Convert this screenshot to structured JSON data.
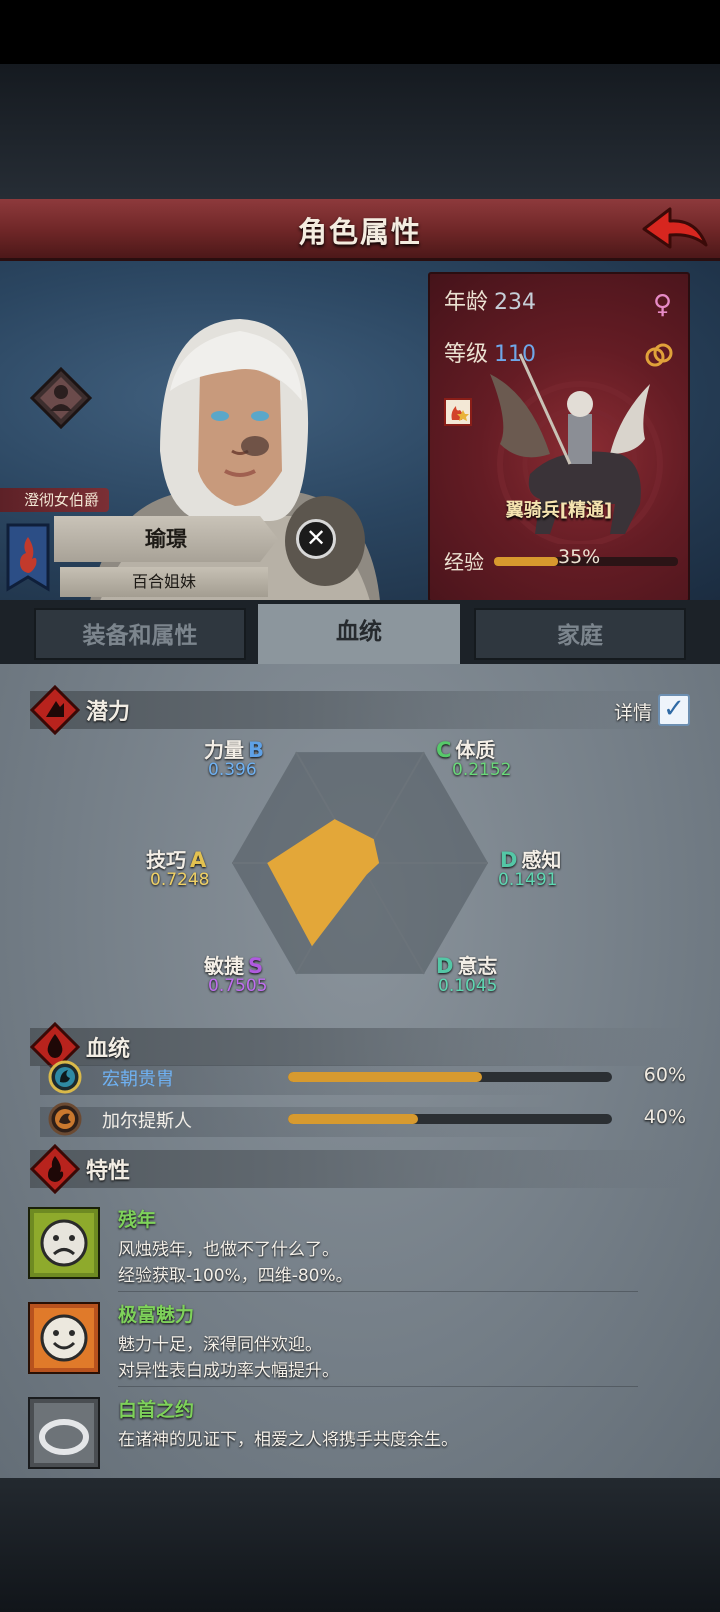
{
  "header": {
    "title": "角色属性"
  },
  "character": {
    "title_badge": "澄彻女伯爵",
    "name": "瑜璟",
    "house": "百合姐妹"
  },
  "unit": {
    "age_label": "年龄",
    "age_value": "234",
    "level_label": "等级",
    "level_value": "110",
    "unit_name": "翼骑兵[精通]",
    "exp_label": "经验",
    "exp_percent": "35%",
    "exp_fraction": 0.35
  },
  "tabs": [
    {
      "label": "装备和属性",
      "active": false
    },
    {
      "label": "血统",
      "active": true
    },
    {
      "label": "家庭",
      "active": false
    }
  ],
  "potential": {
    "section_title": "潜力",
    "detail_label": "详情",
    "detail_checked": true,
    "stats": [
      {
        "label": "力量",
        "grade": "B",
        "value": "0.396"
      },
      {
        "label": "体质",
        "grade": "C",
        "value": "0.2152"
      },
      {
        "label": "感知",
        "grade": "D",
        "value": "0.1491"
      },
      {
        "label": "意志",
        "grade": "D",
        "value": "0.1045"
      },
      {
        "label": "敏捷",
        "grade": "S",
        "value": "0.7505"
      },
      {
        "label": "技巧",
        "grade": "A",
        "value": "0.7248"
      }
    ]
  },
  "bloodline": {
    "section_title": "血统",
    "items": [
      {
        "name": "宏朝贵胄",
        "percent": "60%",
        "fraction": 0.6
      },
      {
        "name": "加尔提斯人",
        "percent": "40%",
        "fraction": 0.4
      }
    ]
  },
  "traits": {
    "section_title": "特性",
    "items": [
      {
        "name": "残年",
        "line1": "风烛残年，也做不了什么了。",
        "line2": "经验获取-100%，四维-80%。"
      },
      {
        "name": "极富魅力",
        "line1": "魅力十足，深得同伴欢迎。",
        "line2": "对异性表白成功率大幅提升。"
      },
      {
        "name": "白首之约",
        "line1": "在诸神的见证下，相爱之人将携手共度余生。",
        "line2": ""
      }
    ]
  },
  "colors": {
    "header_red": "#7a2c2e",
    "grade_S": "#b05ae0",
    "grade_A": "#e2c150",
    "grade_B": "#5fa1e6",
    "grade_C": "#57c96a",
    "grade_D": "#54c7a6",
    "bar_fill": "#d79a2f",
    "trait_green": "#7ed25a"
  }
}
